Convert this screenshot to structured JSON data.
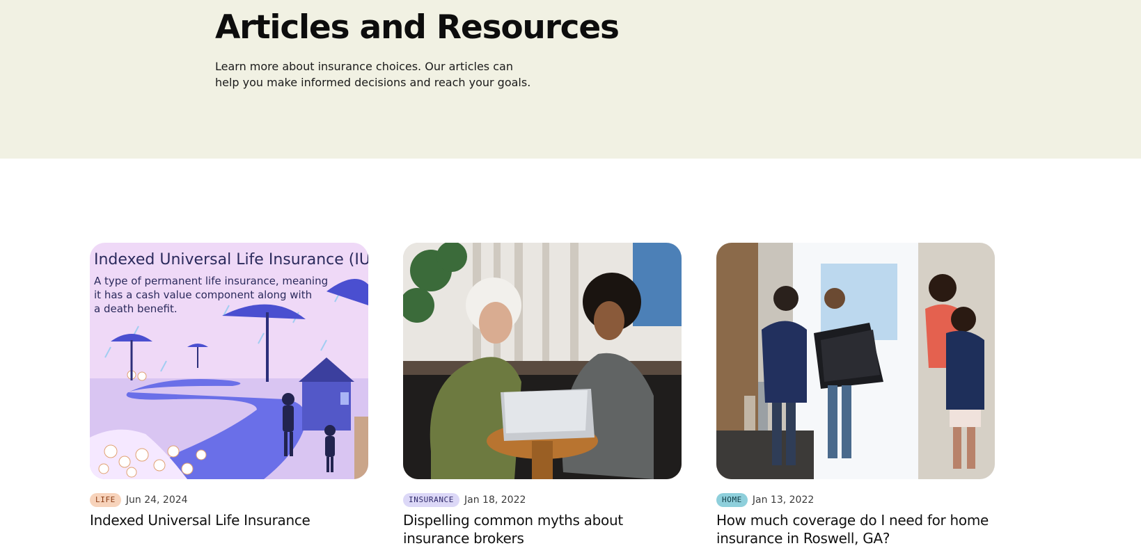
{
  "hero": {
    "title": "Articles and Resources",
    "description": "Learn more about insurance choices. Our articles can help you make informed decisions and reach your goals."
  },
  "cards": [
    {
      "tag": "LIFE",
      "tag_bg": "#f7d3bb",
      "tag_fg": "#8a3a12",
      "date": "Jun 24, 2024",
      "title": "Indexed Universal Life Insurance",
      "image_heading": "Indexed Universal Life Insurance (IUL)",
      "image_line1": "A type of permanent life insurance, meaning",
      "image_line2": "it has a cash value component along with",
      "image_line3": "a death benefit."
    },
    {
      "tag": "INSURANCE",
      "tag_bg": "#dcd8f7",
      "tag_fg": "#2d2769",
      "date": "Jan 18, 2022",
      "title": "Dispelling common myths about insurance brokers"
    },
    {
      "tag": "HOME",
      "tag_bg": "#8ecfdb",
      "tag_fg": "#0f3b45",
      "date": "Jan 13, 2022",
      "title": "How much coverage do I need for home insurance in Roswell, GA?"
    }
  ]
}
